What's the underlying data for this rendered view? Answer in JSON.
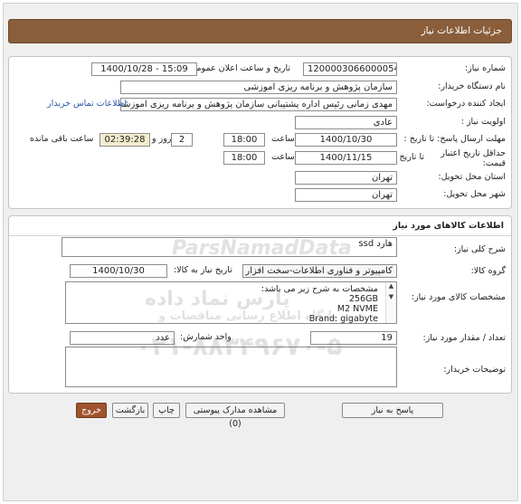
{
  "header": {
    "title": "جزئیات اطلاعات نیاز"
  },
  "need": {
    "number_label": "شماره نیاز:",
    "number_value": "1200003066000054",
    "announce_label": "تاریخ و ساعت اعلان عمومی:",
    "announce_value": "1400/10/28 - 15:09",
    "buyer_org_label": "نام دستگاه خریدار:",
    "buyer_org_value": "سازمان پژوهش و برنامه ریزی اموزشی",
    "requester_label": "ایجاد کننده درخواست:",
    "requester_value": "مهدی زمانی رئیس اداره پشتیبانی سازمان پژوهش و برنامه ریزی اموزشی",
    "contact_link": "اطلاعات تماس خریدار",
    "priority_label": "اولویت نیاز :",
    "priority_value": "عادی",
    "send_deadline_label": "مهلت ارسال پاسخ: تا تاریخ :",
    "send_deadline_date": "1400/10/30",
    "time_label": "ساعت",
    "send_deadline_time": "18:00",
    "days_value": "2",
    "days_label": "روز و",
    "remaining_time": "02:39:28",
    "remaining_label": "ساعت باقی مانده",
    "validity_label": "حداقل تاریخ اعتبار قیمت:",
    "validity_to_label": "تا تاریخ :",
    "validity_date": "1400/11/15",
    "validity_time": "18:00",
    "province_label": "استان محل تحویل:",
    "province_value": "تهران",
    "city_label": "شهر محل تحویل:",
    "city_value": "تهران"
  },
  "goods": {
    "section_title": "اطلاعات کالاهای مورد نیاز",
    "summary_label": "شرح کلی نیاز:",
    "summary_value": "هارد ssd",
    "group_label": "گروه کالا:",
    "group_value": "کامپیوتر و فناوری اطلاعات-سخت افزار",
    "need_date_label": "تاریخ نیاز به کالا:",
    "need_date_value": "1400/10/30",
    "specs_label": "مشخصات کالای مورد نیاز:",
    "specs_lines": [
      "مشخصات به شرح زیر می باشد:",
      "256GB",
      "M2 NVME",
      "Brand: gigabyte"
    ],
    "qty_label": "تعداد / مقدار مورد نیاز:",
    "qty_value": "19",
    "unit_label": "واحد شمارش:",
    "unit_value": "عدد",
    "buyer_notes_label": "توضیحات خریدار:",
    "buyer_notes_value": ""
  },
  "buttons": {
    "reply": "پاسخ به نیاز",
    "attachments": "مشاهده مدارک پیوستی (0)",
    "print": "چاپ",
    "back": "بازگشت",
    "exit": "خروج"
  },
  "watermark": {
    "brand": "ParsNamadData",
    "line1": "پارس نماد داده",
    "line2": "پایگاه اطلاع رسانی مناقصات و",
    "phone": "۰۲۱-۸۸۳۴۹۶۷۰-۵"
  },
  "colors": {
    "title_bar": "#8a5e3b",
    "link": "#2c56a8",
    "exit_button": "#a0522d"
  }
}
